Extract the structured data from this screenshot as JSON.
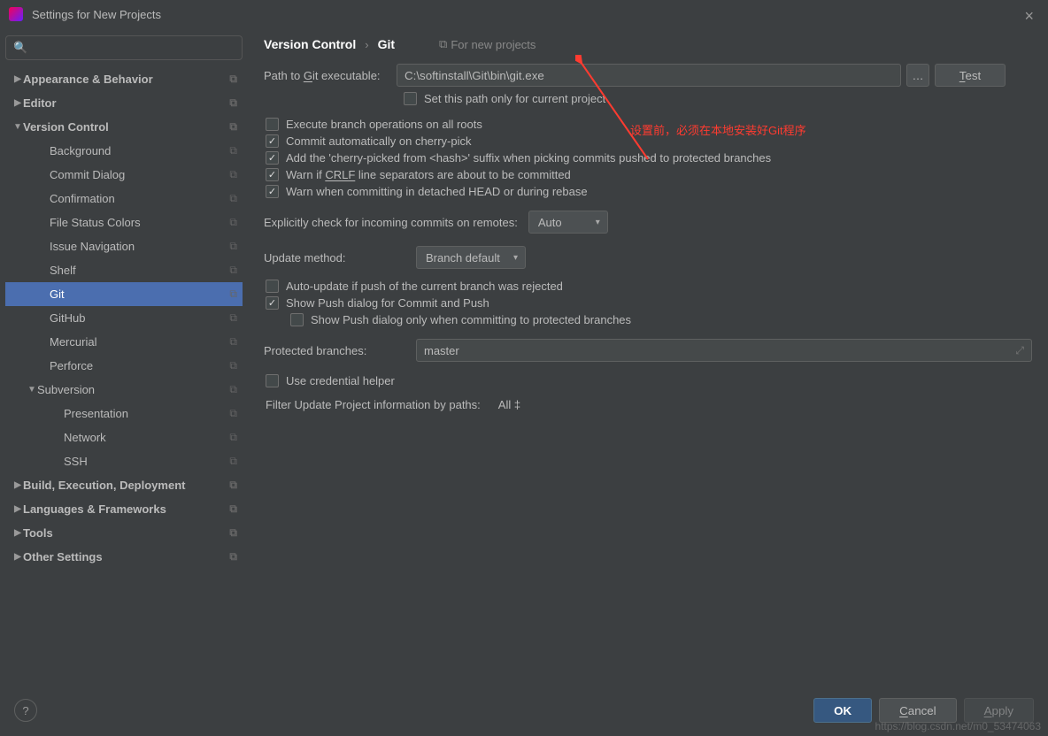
{
  "window": {
    "title": "Settings for New Projects"
  },
  "breadcrumb": {
    "root": "Version Control",
    "leaf": "Git",
    "fornew": "For new projects"
  },
  "sidebar": {
    "items": [
      {
        "label": "Appearance & Behavior",
        "lvl": "lvl0",
        "arrow": "▶"
      },
      {
        "label": "Editor",
        "lvl": "lvl0",
        "arrow": "▶"
      },
      {
        "label": "Version Control",
        "lvl": "lvl0",
        "arrow": "▼"
      },
      {
        "label": "Background",
        "lvl": "lvl1",
        "arrow": ""
      },
      {
        "label": "Commit Dialog",
        "lvl": "lvl1",
        "arrow": ""
      },
      {
        "label": "Confirmation",
        "lvl": "lvl1",
        "arrow": ""
      },
      {
        "label": "File Status Colors",
        "lvl": "lvl1",
        "arrow": ""
      },
      {
        "label": "Issue Navigation",
        "lvl": "lvl1",
        "arrow": ""
      },
      {
        "label": "Shelf",
        "lvl": "lvl1",
        "arrow": ""
      },
      {
        "label": "Git",
        "lvl": "lvl1",
        "arrow": "",
        "selected": true
      },
      {
        "label": "GitHub",
        "lvl": "lvl1",
        "arrow": ""
      },
      {
        "label": "Mercurial",
        "lvl": "lvl1",
        "arrow": ""
      },
      {
        "label": "Perforce",
        "lvl": "lvl1",
        "arrow": ""
      },
      {
        "label": "Subversion",
        "lvl": "lvlT",
        "arrow": "▼"
      },
      {
        "label": "Presentation",
        "lvl": "lvl2",
        "arrow": ""
      },
      {
        "label": "Network",
        "lvl": "lvl2",
        "arrow": ""
      },
      {
        "label": "SSH",
        "lvl": "lvl2",
        "arrow": ""
      },
      {
        "label": "Build, Execution, Deployment",
        "lvl": "lvl0",
        "arrow": "▶"
      },
      {
        "label": "Languages & Frameworks",
        "lvl": "lvl0",
        "arrow": "▶"
      },
      {
        "label": "Tools",
        "lvl": "lvl0",
        "arrow": "▶"
      },
      {
        "label": "Other Settings",
        "lvl": "lvl0",
        "arrow": "▶"
      }
    ]
  },
  "git": {
    "path_label_pre": "Path to ",
    "path_label_u": "G",
    "path_label_post": "it executable:",
    "path_value": "C:\\softinstall\\Git\\bin\\git.exe",
    "test_u": "T",
    "test_rest": "est",
    "set_path_only": "Set this path only for current project",
    "chk1": "Execute branch operations on all roots",
    "chk2": "Commit automatically on cherry-pick",
    "chk3": "Add the 'cherry-picked from <hash>' suffix when picking commits pushed to protected branches",
    "chk4_pre": "Warn if ",
    "chk4_u": "CRLF",
    "chk4_post": " line separators are about to be committed",
    "chk5": "Warn when committing in detached HEAD or during rebase",
    "explicit_label": "Explicitly check for incoming commits on remotes:",
    "explicit_value": "Auto",
    "update_label": "Update method:",
    "update_value": "Branch default",
    "chk6": "Auto-update if push of the current branch was rejected",
    "chk7": "Show Push dialog for Commit and Push",
    "chk8": "Show Push dialog only when committing to protected branches",
    "protected_label": "Protected branches:",
    "protected_value": "master",
    "chk9": "Use credential helper",
    "filter_label": "Filter Update Project information by paths:",
    "filter_value": "All"
  },
  "annotation": {
    "text": "设置前，必须在本地安装好Git程序"
  },
  "footer": {
    "ok": "OK",
    "cancel_u": "C",
    "cancel_rest": "ancel",
    "apply_u": "A",
    "apply_rest": "pply"
  },
  "watermark": "https://blog.csdn.net/m0_53474063"
}
